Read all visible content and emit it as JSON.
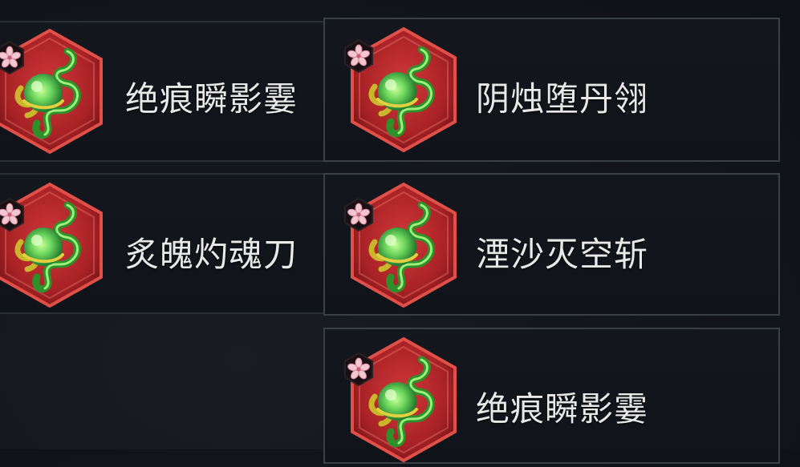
{
  "items": [
    {
      "name": "绝痕瞬影霎",
      "icon": "jade-serpent-relic-icon",
      "badge": "sakura-flower-icon"
    },
    {
      "name": "阴烛堕丹翎",
      "icon": "jade-serpent-relic-icon",
      "badge": "sakura-flower-icon"
    },
    {
      "name": "炙魄灼魂刀",
      "icon": "jade-serpent-relic-icon",
      "badge": "sakura-flower-icon"
    },
    {
      "name": "湮沙灭空斩",
      "icon": "jade-serpent-relic-icon",
      "badge": "sakura-flower-icon"
    },
    {
      "name": "绝痕瞬影霎",
      "icon": "jade-serpent-relic-icon",
      "badge": "sakura-flower-icon"
    }
  ],
  "colors": {
    "hex_fill": "#b8282c",
    "hex_border": "#e04a44",
    "jade": "#5fd05a",
    "text": "#e8e8e8"
  }
}
